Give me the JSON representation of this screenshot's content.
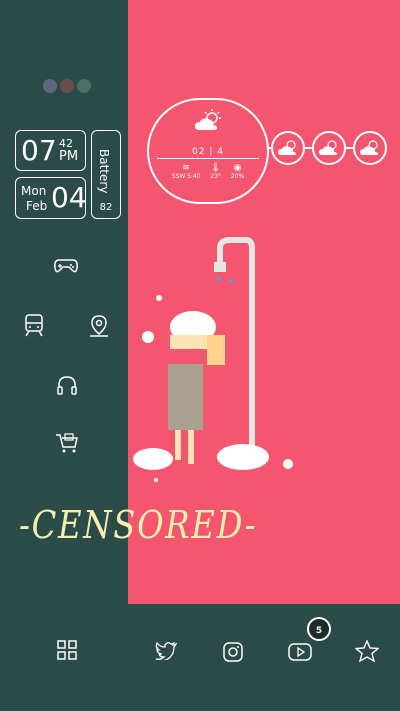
{
  "clock": {
    "hour": "07",
    "minute": "42",
    "ampm": "PM"
  },
  "date": {
    "weekday": "Mon",
    "month": "Feb",
    "day": "04"
  },
  "battery": {
    "label": "Battery",
    "value": "82"
  },
  "weather": {
    "date": "02 | 4",
    "wind_dir": "SSW",
    "wind_speed": "5.40",
    "temperature": "23°",
    "humidity": "20%"
  },
  "overlay_text": "-CENSORED-",
  "dock": {
    "badge_count": "5"
  },
  "colors": {
    "panel_dark": "#2a4b47",
    "panel_pink": "#f4566f",
    "accent_text": "#f2efb0"
  },
  "icons": [
    "gamepad-icon",
    "train-icon",
    "location-pin-icon",
    "headphones-icon",
    "shopping-cart-icon",
    "apps-grid-icon",
    "twitter-icon",
    "instagram-icon",
    "youtube-icon",
    "star-icon",
    "cloud-sun-icon"
  ]
}
